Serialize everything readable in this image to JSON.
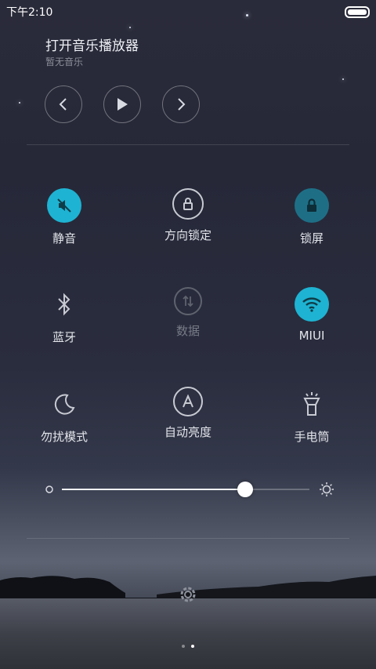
{
  "status_bar": {
    "time": "下午2:10"
  },
  "music": {
    "title": "打开音乐播放器",
    "subtitle": "暂无音乐"
  },
  "toggles": [
    {
      "label": "静音",
      "icon": "mute-icon",
      "state": "on"
    },
    {
      "label": "方向锁定",
      "icon": "rotation-lock-icon",
      "state": "off"
    },
    {
      "label": "锁屏",
      "icon": "lock-icon",
      "state": "on"
    },
    {
      "label": "蓝牙",
      "icon": "bluetooth-icon",
      "state": "off"
    },
    {
      "label": "数据",
      "icon": "mobile-data-icon",
      "state": "disabled"
    },
    {
      "label": "MIUI",
      "icon": "wifi-icon",
      "state": "on"
    },
    {
      "label": "勿扰模式",
      "icon": "moon-icon",
      "state": "off"
    },
    {
      "label": "自动亮度",
      "icon": "auto-brightness-icon",
      "state": "off"
    },
    {
      "label": "手电筒",
      "icon": "flashlight-icon",
      "state": "off"
    }
  ],
  "brightness": {
    "level": 0.74
  },
  "colors": {
    "accent": "#1eb3d2",
    "lock_accent": "#1e6f86"
  },
  "pager": {
    "pages": 2,
    "active": 2
  }
}
